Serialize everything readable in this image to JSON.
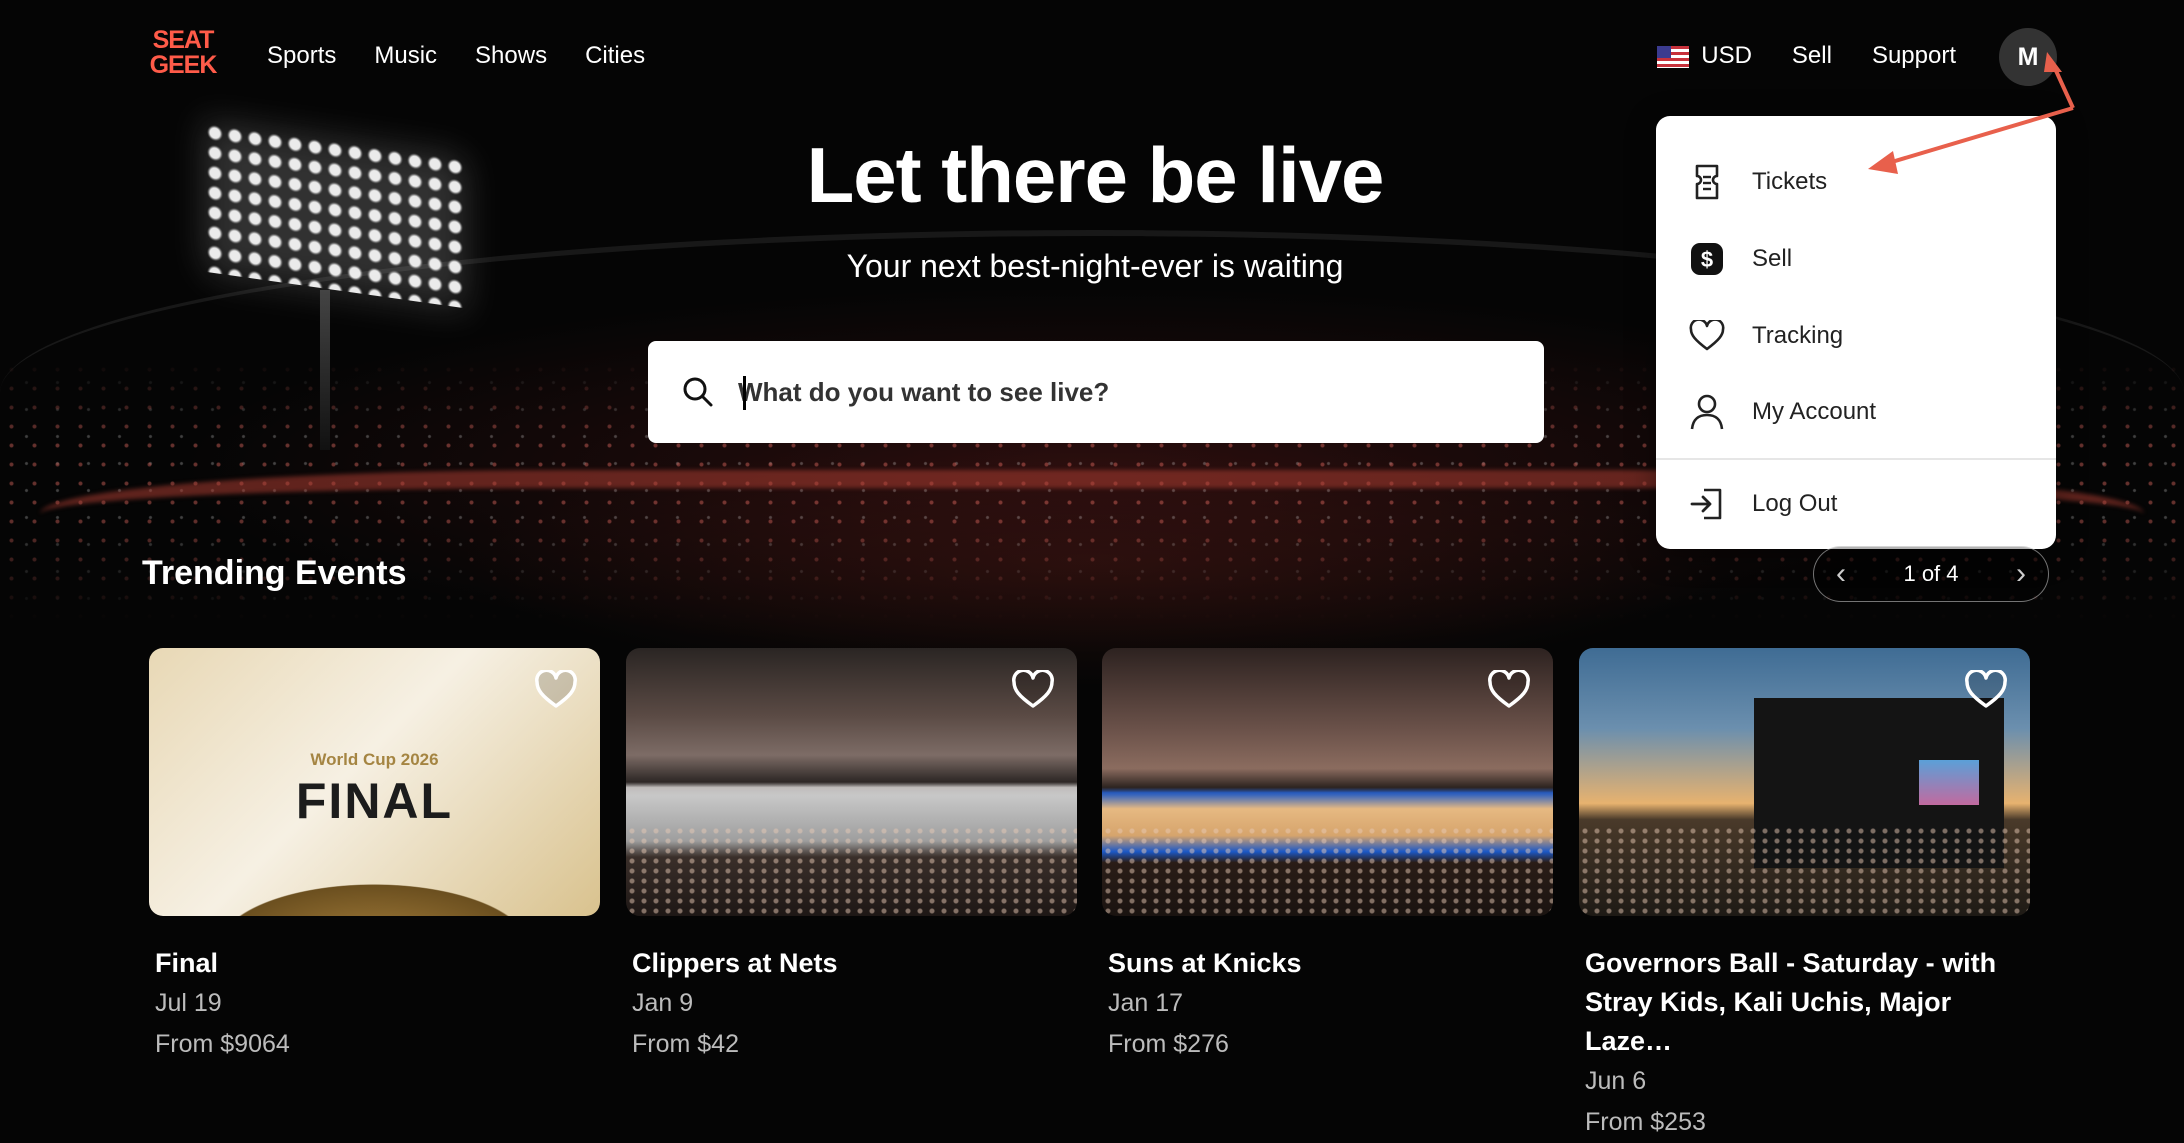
{
  "header": {
    "logo": "SEAT GEEK",
    "nav": [
      "Sports",
      "Music",
      "Shows",
      "Cities"
    ],
    "currency": "USD",
    "sell": "Sell",
    "support": "Support",
    "avatar_initial": "M"
  },
  "hero": {
    "title": "Let there be live",
    "subtitle": "Your next best-night-ever is waiting",
    "search_placeholder": "What do you want to see live?"
  },
  "account_menu": {
    "items": [
      {
        "label": "Tickets",
        "icon": "ticket-icon"
      },
      {
        "label": "Sell",
        "icon": "dollar-icon"
      },
      {
        "label": "Tracking",
        "icon": "heart-icon"
      },
      {
        "label": "My Account",
        "icon": "user-icon"
      },
      {
        "label": "Log Out",
        "icon": "logout-icon"
      }
    ]
  },
  "trending": {
    "title": "Trending Events",
    "pager": "1 of 4",
    "events": [
      {
        "title": "Final",
        "date": "Jul 19",
        "price": "From $9064",
        "image_text_1": "World Cup 2026",
        "image_text_2": "FINAL"
      },
      {
        "title": "Clippers at Nets",
        "date": "Jan 9",
        "price": "From $42"
      },
      {
        "title": "Suns at Knicks",
        "date": "Jan 17",
        "price": "From $276"
      },
      {
        "title": "Governors Ball - Saturday - with Stray Kids, Kali Uchis, Major Laze…",
        "date": "Jun 6",
        "price": "From $253"
      }
    ]
  },
  "colors": {
    "brand": "#ff5b49",
    "annotation_arrow": "#e8604c",
    "background": "#050505"
  }
}
